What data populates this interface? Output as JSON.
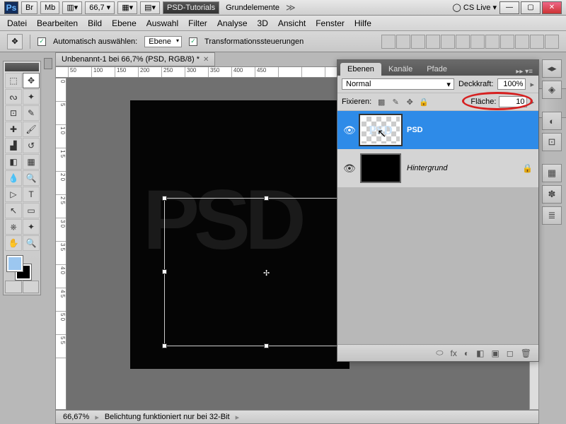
{
  "topbar": {
    "zoom_select": "66,7",
    "tab1": "PSD-Tutorials",
    "tab2": "Grundelemente",
    "cslive": "CS Live"
  },
  "menu": [
    "Datei",
    "Bearbeiten",
    "Bild",
    "Ebene",
    "Auswahl",
    "Filter",
    "Analyse",
    "3D",
    "Ansicht",
    "Fenster",
    "Hilfe"
  ],
  "optbar": {
    "autoselect": "Automatisch auswählen:",
    "layer_type": "Ebene",
    "transform": "Transformationssteuerungen"
  },
  "doc": {
    "tab": "Unbenannt-1 bei 66,7% (PSD, RGB/8) *",
    "text": "PSD"
  },
  "ruler_h": [
    "50",
    "100",
    "150",
    "200",
    "250",
    "300",
    "350",
    "400",
    "450"
  ],
  "ruler_v": [
    "0",
    "5",
    "1 0",
    "1 5",
    "2 0",
    "2 5",
    "3 0",
    "3 5",
    "4 0",
    "4 5",
    "5 0",
    "5 5"
  ],
  "status": {
    "zoom": "66,67%",
    "msg": "Belichtung funktioniert nur bei 32-Bit"
  },
  "layers": {
    "tabs": [
      "Ebenen",
      "Kanäle",
      "Pfade"
    ],
    "blend": "Normal",
    "opacity_label": "Deckkraft:",
    "opacity": "100%",
    "lock_label": "Fixieren:",
    "fill_label": "Fläche:",
    "fill": "10",
    "items": [
      {
        "name": "PSD",
        "thumb_text": "PSD"
      },
      {
        "name": "Hintergrund"
      }
    ],
    "footer_icons": [
      "⬭",
      "fx",
      "◐",
      "◧",
      "▣",
      "◻",
      "🗑"
    ]
  }
}
